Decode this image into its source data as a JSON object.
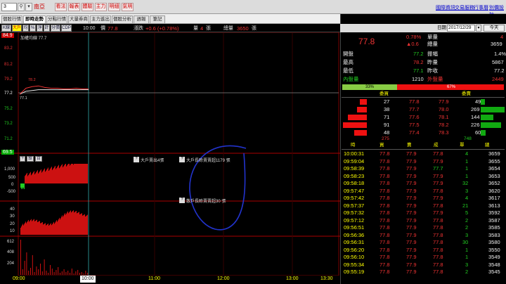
{
  "topbar": {
    "code_value": "3",
    "stock_name": "南亞",
    "action_buttons": [
      "看法",
      "報表",
      "體驗",
      "主力",
      "明細",
      "氣明"
    ],
    "right_links": [
      "國際資訊",
      "交易服務",
      "行事曆",
      "別價設計"
    ]
  },
  "tabs": [
    "個股行情",
    "即時走勢",
    "分點行情",
    "大量券商",
    "主力進出",
    "個股分析",
    "週報",
    "筆記"
  ],
  "toolbar": {
    "buttons": [
      "K線",
      "大戶",
      "均",
      "%",
      "淨",
      "計",
      "分價",
      "CDP"
    ],
    "time": "10:00",
    "price_label": "價",
    "price_value": "77.8",
    "change_label": "漲跌",
    "change_value": "+0.6 (+0.78%)",
    "qty_label": "量",
    "qty_value": "4",
    "qty_unit": "張",
    "total_label": "總量",
    "total_value": "3650",
    "total_unit": "張"
  },
  "chart": {
    "main_label": "加權均線 77.7",
    "price_ticks": [
      "84.9",
      "83.2",
      "81.2",
      "79.2",
      "77.2",
      "75.2",
      "73.2",
      "71.2",
      "69.5"
    ],
    "peak_label": "78.2",
    "low_label": "77.1",
    "indicator_buttons": [
      "?",
      "設",
      "目"
    ],
    "big_label1": "大戶賣出4張",
    "big_label2": "大戶長賒賣賣超1179 張",
    "scatter_label": "散戶長賒賣賣超30 張",
    "sub1_ticks": [
      "1,000",
      "500",
      "0",
      "-500"
    ],
    "sub2_ticks": [
      "40",
      "30",
      "20",
      "10"
    ],
    "sub3_ticks": [
      "612",
      "408",
      "204"
    ],
    "cursor_time": "10:00",
    "time_ticks": [
      "09:00",
      "11:00",
      "12:00",
      "13:00",
      "13:30"
    ],
    "price_line": [
      77.1,
      77.9,
      78.1,
      78.2,
      78.0,
      77.9,
      77.9,
      77.8,
      77.8,
      77.9,
      77.8,
      77.8
    ],
    "avg_line": [
      77.1,
      77.5,
      77.6,
      77.7,
      77.7,
      77.7,
      77.7,
      77.7,
      77.7,
      77.7,
      77.7,
      77.7
    ],
    "colors": {
      "up": "#e33",
      "down": "#2c2",
      "axis": "#a00",
      "yellow": "#ff0"
    }
  },
  "quote": {
    "date_label": "日期",
    "date_value": "2017/12/29",
    "today_label": "今天",
    "last": "77.8",
    "pct": "0.78%",
    "chg": "▲0.6",
    "single_label": "單量",
    "single_value": "4",
    "total_label": "總量",
    "total_value": "3659",
    "rows": [
      {
        "l1": "開盤",
        "v1": "77.2",
        "l2": "振幅",
        "v2": "1.4%"
      },
      {
        "l1": "最高",
        "v1": "78.2",
        "l2": "昨量",
        "v2": "5867"
      },
      {
        "l1": "最低",
        "v1": "77.1",
        "l2": "昨收",
        "v2": "77.2"
      }
    ],
    "inner_label": "內盤量",
    "inner_value": "1210",
    "outer_label": "外盤量",
    "outer_value": "2449",
    "inner_pct": "33%",
    "outer_pct": "67%",
    "book_headers": [
      "委買",
      "委賣"
    ],
    "book": [
      {
        "bq": "27",
        "bp": "77.8",
        "ap": "77.9",
        "aq": "49",
        "bbar": 0.3,
        "abar": 0.18
      },
      {
        "bq": "38",
        "bp": "77.7",
        "ap": "78.0",
        "aq": "269",
        "bbar": 0.42,
        "abar": 1.0
      },
      {
        "bq": "71",
        "bp": "77.6",
        "ap": "78.1",
        "aq": "144",
        "bbar": 0.78,
        "abar": 0.54
      },
      {
        "bq": "91",
        "bp": "77.5",
        "ap": "78.2",
        "aq": "226",
        "bbar": 1.0,
        "abar": 0.84
      },
      {
        "bq": "48",
        "bp": "77.4",
        "ap": "78.3",
        "aq": "60",
        "bbar": 0.53,
        "abar": 0.22
      }
    ],
    "book_totals": [
      "275",
      "748"
    ],
    "trade_headers": [
      "時",
      "買",
      "賣",
      "成",
      "單",
      "總"
    ],
    "trades": [
      {
        "t": "10:00:31",
        "b": "77.8",
        "s": "77.9",
        "p": "77.8",
        "q": "4",
        "tot": "3659"
      },
      {
        "t": "09:59:04",
        "b": "77.8",
        "s": "77.9",
        "p": "77.9",
        "q": "1",
        "tot": "3655"
      },
      {
        "t": "09:58:39",
        "b": "77.8",
        "s": "77.9",
        "p": "77.7",
        "q": "1",
        "tot": "3654"
      },
      {
        "t": "09:58:23",
        "b": "77.8",
        "s": "77.9",
        "p": "77.9",
        "q": "1",
        "tot": "3653"
      },
      {
        "t": "09:58:18",
        "b": "77.8",
        "s": "77.9",
        "p": "77.9",
        "q": "32",
        "tot": "3652"
      },
      {
        "t": "09:57:47",
        "b": "77.8",
        "s": "77.9",
        "p": "77.8",
        "q": "3",
        "tot": "3620"
      },
      {
        "t": "09:57:42",
        "b": "77.8",
        "s": "77.9",
        "p": "77.9",
        "q": "4",
        "tot": "3617"
      },
      {
        "t": "09:57:37",
        "b": "77.8",
        "s": "77.9",
        "p": "77.8",
        "q": "21",
        "tot": "3613"
      },
      {
        "t": "09:57:32",
        "b": "77.8",
        "s": "77.9",
        "p": "77.9",
        "q": "5",
        "tot": "3592"
      },
      {
        "t": "09:57:12",
        "b": "77.8",
        "s": "77.9",
        "p": "77.8",
        "q": "2",
        "tot": "3587"
      },
      {
        "t": "09:56:51",
        "b": "77.8",
        "s": "77.9",
        "p": "77.8",
        "q": "2",
        "tot": "3585"
      },
      {
        "t": "09:56:36",
        "b": "77.8",
        "s": "77.9",
        "p": "77.8",
        "q": "3",
        "tot": "3583"
      },
      {
        "t": "09:56:31",
        "b": "77.8",
        "s": "77.9",
        "p": "77.8",
        "q": "30",
        "tot": "3580"
      },
      {
        "t": "09:56:20",
        "b": "77.8",
        "s": "77.9",
        "p": "77.8",
        "q": "1",
        "tot": "3550"
      },
      {
        "t": "09:56:10",
        "b": "77.8",
        "s": "77.9",
        "p": "77.8",
        "q": "1",
        "tot": "3549"
      },
      {
        "t": "09:55:34",
        "b": "77.8",
        "s": "77.9",
        "p": "77.8",
        "q": "3",
        "tot": "3548"
      },
      {
        "t": "09:55:19",
        "b": "77.8",
        "s": "77.9",
        "p": "77.8",
        "q": "2",
        "tot": "3545"
      }
    ]
  }
}
